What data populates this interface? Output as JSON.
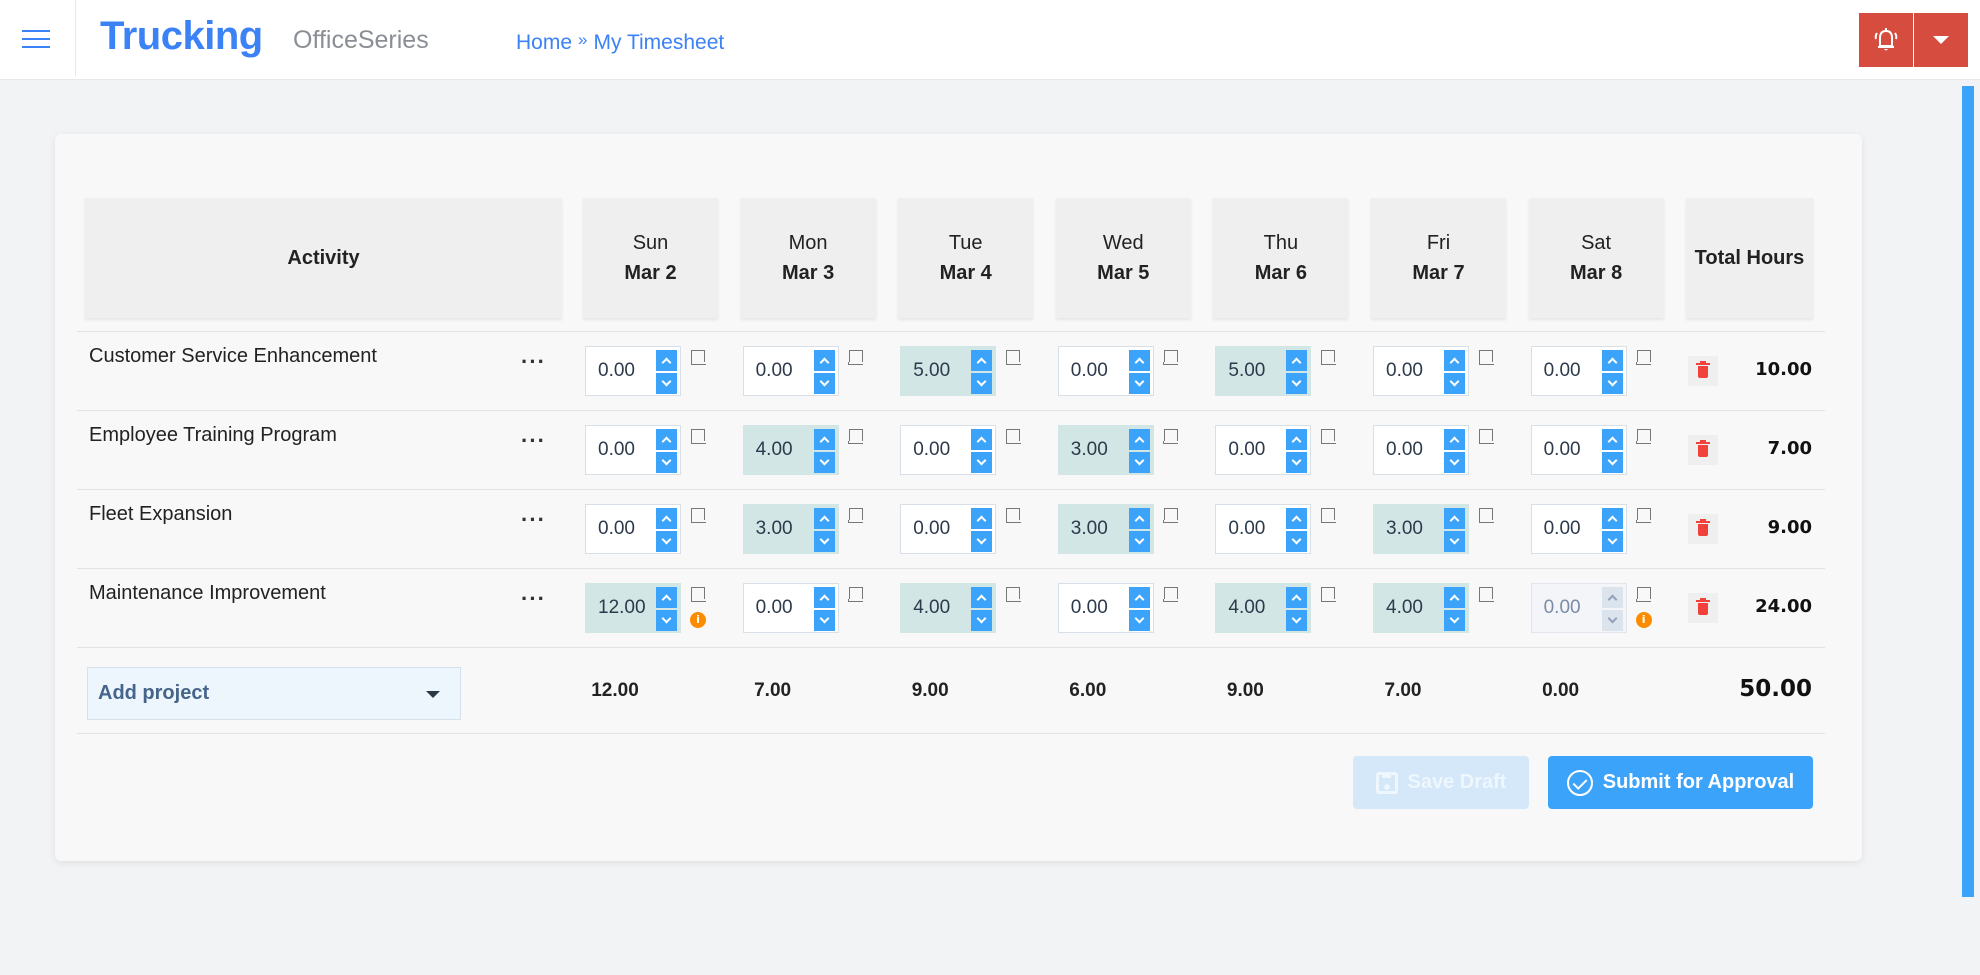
{
  "header": {
    "menu_icon": "hamburger-menu-icon",
    "brand": "Trucking",
    "product": "OfficeSeries",
    "breadcrumb": [
      {
        "label": "Home"
      },
      {
        "label": "My Timesheet"
      }
    ],
    "breadcrumb_separator": "»",
    "alert_icon": "bell-alert-icon",
    "dropdown_icon": "caret-down-icon",
    "accent_color": "#3b82f6",
    "alert_color": "#d64c3f"
  },
  "timesheet": {
    "columns": {
      "activity": "Activity",
      "total": "Total Hours",
      "days": [
        {
          "day": "Sun",
          "date": "Mar 2"
        },
        {
          "day": "Mon",
          "date": "Mar 3"
        },
        {
          "day": "Tue",
          "date": "Mar 4"
        },
        {
          "day": "Wed",
          "date": "Mar 5"
        },
        {
          "day": "Thu",
          "date": "Mar 6"
        },
        {
          "day": "Fri",
          "date": "Mar 7"
        },
        {
          "day": "Sat",
          "date": "Mar 8"
        }
      ]
    },
    "rows": [
      {
        "activity": "Customer Service Enhancement",
        "hours": [
          "0.00",
          "0.00",
          "5.00",
          "0.00",
          "5.00",
          "0.00",
          "0.00"
        ],
        "warnings": [
          false,
          false,
          false,
          false,
          false,
          false,
          false
        ],
        "disabled": [
          false,
          false,
          false,
          false,
          false,
          false,
          false
        ],
        "total": "10.00"
      },
      {
        "activity": "Employee Training Program",
        "hours": [
          "0.00",
          "4.00",
          "0.00",
          "3.00",
          "0.00",
          "0.00",
          "0.00"
        ],
        "warnings": [
          false,
          false,
          false,
          false,
          false,
          false,
          false
        ],
        "disabled": [
          false,
          false,
          false,
          false,
          false,
          false,
          false
        ],
        "total": "7.00"
      },
      {
        "activity": "Fleet Expansion",
        "hours": [
          "0.00",
          "3.00",
          "0.00",
          "3.00",
          "0.00",
          "3.00",
          "0.00"
        ],
        "warnings": [
          false,
          false,
          false,
          false,
          false,
          false,
          false
        ],
        "disabled": [
          false,
          false,
          false,
          false,
          false,
          false,
          false
        ],
        "total": "9.00"
      },
      {
        "activity": "Maintenance Improvement",
        "hours": [
          "12.00",
          "0.00",
          "4.00",
          "0.00",
          "4.00",
          "4.00",
          "0.00"
        ],
        "warnings": [
          true,
          false,
          false,
          false,
          false,
          false,
          true
        ],
        "disabled": [
          false,
          false,
          false,
          false,
          false,
          false,
          true
        ],
        "total": "24.00"
      }
    ],
    "row_menu_label": "···",
    "warning_glyph": "i",
    "footer": {
      "add_project_label": "Add project",
      "day_totals": [
        "12.00",
        "7.00",
        "9.00",
        "6.00",
        "9.00",
        "7.00",
        "0.00"
      ],
      "grand_total": "50.00"
    }
  },
  "actions": {
    "save_draft": "Save Draft",
    "save_draft_enabled": false,
    "submit": "Submit for Approval",
    "primary_color": "#3ca3fb"
  }
}
